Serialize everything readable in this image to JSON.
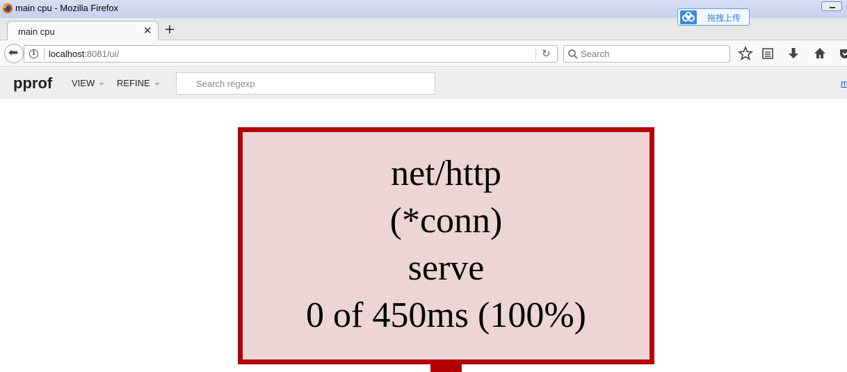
{
  "window": {
    "title": "main cpu - Mozilla Firefox",
    "extension_label": "拖拽上传"
  },
  "tabs": [
    {
      "label": "main cpu",
      "active": true
    }
  ],
  "navbar": {
    "url_host": "localhost",
    "url_rest": ":8081/ui/",
    "search_placeholder": "Search"
  },
  "pprof": {
    "title": "pprof",
    "menus": [
      "VIEW",
      "REFINE"
    ],
    "regexp_placeholder": "Search regexp",
    "right_link": "m"
  },
  "graph": {
    "node": {
      "lines": [
        "net/http",
        "(*conn)",
        "serve",
        "0 of 450ms (100%)"
      ],
      "fill_color": "#edd5d5",
      "border_color": "#b20000"
    }
  },
  "icons": [
    "firefox-icon",
    "cloud-icon",
    "close-icon",
    "plus-icon",
    "back-arrow-icon",
    "info-icon",
    "reload-icon",
    "search-icon",
    "star-icon",
    "reading-list-icon",
    "download-icon",
    "home-icon",
    "pocket-icon"
  ]
}
